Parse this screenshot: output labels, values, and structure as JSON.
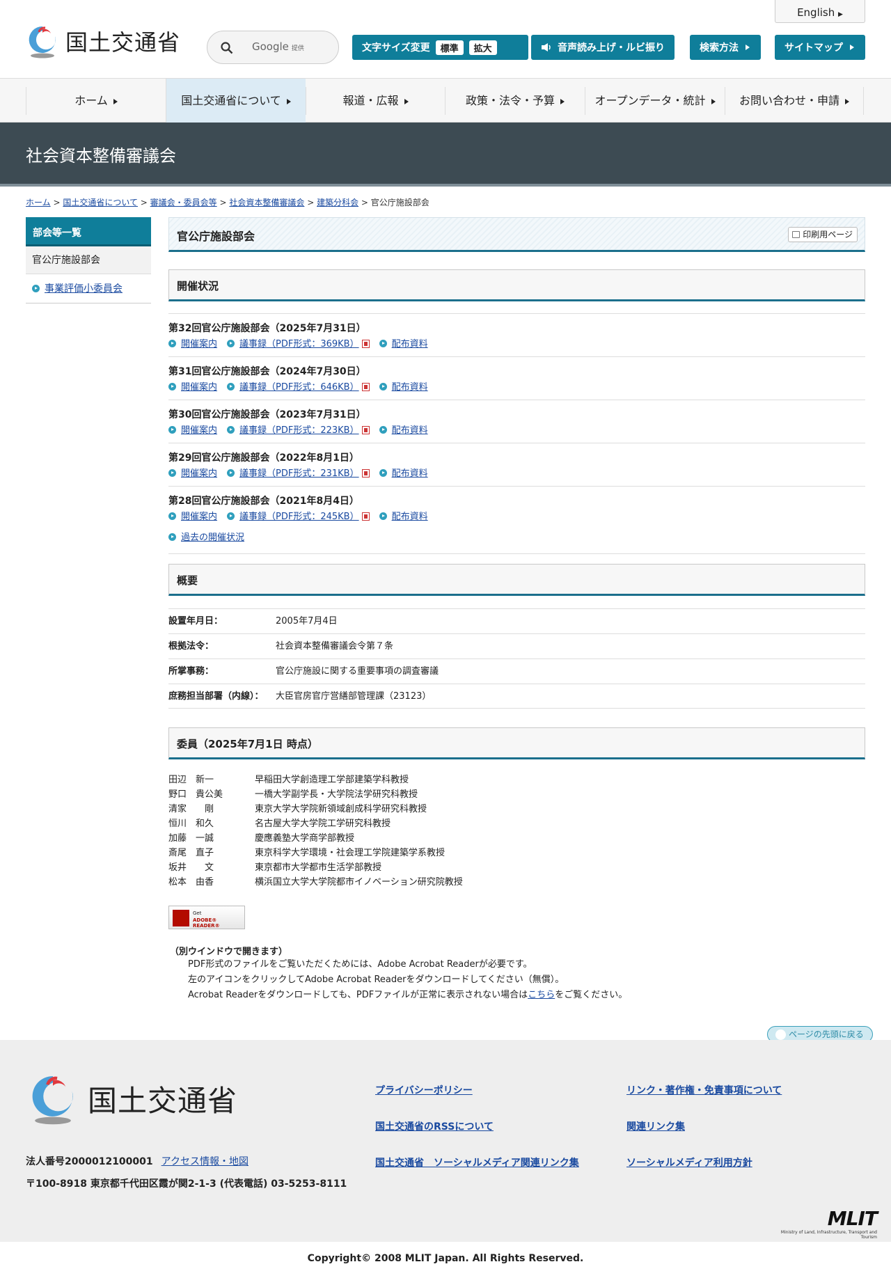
{
  "header": {
    "logo_text": "国土交通省",
    "english": "English",
    "search": {
      "brand": "Google",
      "sub": "提供"
    },
    "font_size": {
      "label": "文字サイズ変更",
      "standard": "標準",
      "large": "拡大"
    },
    "speech": "音声読み上げ・ルビ振り",
    "search_method": "検索方法",
    "sitemap": "サイトマップ"
  },
  "nav": [
    "ホーム",
    "国土交通省について",
    "報道・広報",
    "政策・法令・予算",
    "オープンデータ・統計",
    "お問い合わせ・申請"
  ],
  "page_title_band": "社会資本整備審議会",
  "breadcrumb": [
    "ホーム",
    "国土交通省について",
    "審議会・委員会等",
    "社会資本整備審議会",
    "建築分科会",
    "官公庁施設部会"
  ],
  "sidebar": {
    "heading": "部会等一覧",
    "current": "官公庁施設部会",
    "link": "事業評価小委員会"
  },
  "main": {
    "title": "官公庁施設部会",
    "print": "印刷用ページ",
    "status_heading": "開催状況",
    "meetings": [
      {
        "title": "第32回官公庁施設部会（2025年7月31日）",
        "guide": "開催案内",
        "minutes": "議事録（PDF形式：369KB）",
        "materials": "配布資料"
      },
      {
        "title": "第31回官公庁施設部会（2024年7月30日）",
        "guide": "開催案内",
        "minutes": "議事録（PDF形式：646KB）",
        "materials": "配布資料"
      },
      {
        "title": "第30回官公庁施設部会（2023年7月31日）",
        "guide": "開催案内",
        "minutes": "議事録（PDF形式：223KB）",
        "materials": "配布資料"
      },
      {
        "title": "第29回官公庁施設部会（2022年8月1日）",
        "guide": "開催案内",
        "minutes": "議事録（PDF形式：231KB）",
        "materials": "配布資料"
      },
      {
        "title": "第28回官公庁施設部会（2021年8月4日）",
        "guide": "開催案内",
        "minutes": "議事録（PDF形式：245KB）",
        "materials": "配布資料"
      }
    ],
    "past": "過去の開催状況",
    "overview_heading": "概要",
    "overview": [
      {
        "k": "設置年月日：",
        "v": "2005年7月4日"
      },
      {
        "k": "根拠法令：",
        "v": "社会資本整備審議会令第７条"
      },
      {
        "k": "所掌事務：",
        "v": "官公庁施設に関する重要事項の調査審議"
      },
      {
        "k": "庶務担当部署（内線）：",
        "v": "大臣官房官庁営繕部管理課（23123）"
      }
    ],
    "members_heading": "委員（2025年7月1日 時点）",
    "members": [
      {
        "name": "田辺　新一",
        "role": "早稲田大学創造理工学部建築学科教授"
      },
      {
        "name": "野口　貴公美",
        "role": "一橋大学副学長・大学院法学研究科教授"
      },
      {
        "name": "清家　　剛",
        "role": "東京大学大学院新領域創成科学研究科教授"
      },
      {
        "name": "恒川　和久",
        "role": "名古屋大学大学院工学研究科教授"
      },
      {
        "name": "加藤　一誠",
        "role": "慶應義塾大学商学部教授"
      },
      {
        "name": "斎尾　直子",
        "role": "東京科学大学環境・社会理工学院建築学系教授"
      },
      {
        "name": "坂井　　文",
        "role": "東京都市大学都市生活学部教授"
      },
      {
        "name": "松本　由香",
        "role": "横浜国立大学大学院都市イノベーション研究院教授"
      }
    ],
    "adobe": {
      "get": "Get",
      "reader": "ADOBE® READER®"
    },
    "note_head": "（別ウインドウで開きます）",
    "note_1": "PDF形式のファイルをご覧いただくためには、Adobe Acrobat Readerが必要です。",
    "note_2": "左のアイコンをクリックしてAdobe Acrobat Readerをダウンロードしてください（無償）。",
    "note_3a": "Acrobat Readerをダウンロードしても、PDFファイルが正常に表示されない場合は",
    "note_3link": "こちら",
    "note_3b": "をご覧ください。",
    "to_top": "ページの先頭に戻る"
  },
  "footer": {
    "logo_text": "国土交通省",
    "corp_no": "法人番号2000012100001",
    "access": "アクセス情報・地図",
    "address": "〒100-8918 東京都千代田区霞が関2-1-3 (代表電話) 03-5253-8111",
    "links": [
      "プライバシーポリシー",
      "リンク・著作権・免責事項について",
      "国土交通省のRSSについて",
      "関連リンク集",
      "国土交通省　ソーシャルメディア関連リンク集",
      "ソーシャルメディア利用方針"
    ],
    "mlit": "MLIT",
    "mlit_sub": "Ministry of Land, Infrastructure, Transport and Tourism",
    "copyright": "Copyright© 2008 MLIT Japan. All Rights Reserved."
  },
  "colors": {
    "accent": "#0f7e9a",
    "band": "#3d4b53",
    "link": "#1a4aa0"
  }
}
